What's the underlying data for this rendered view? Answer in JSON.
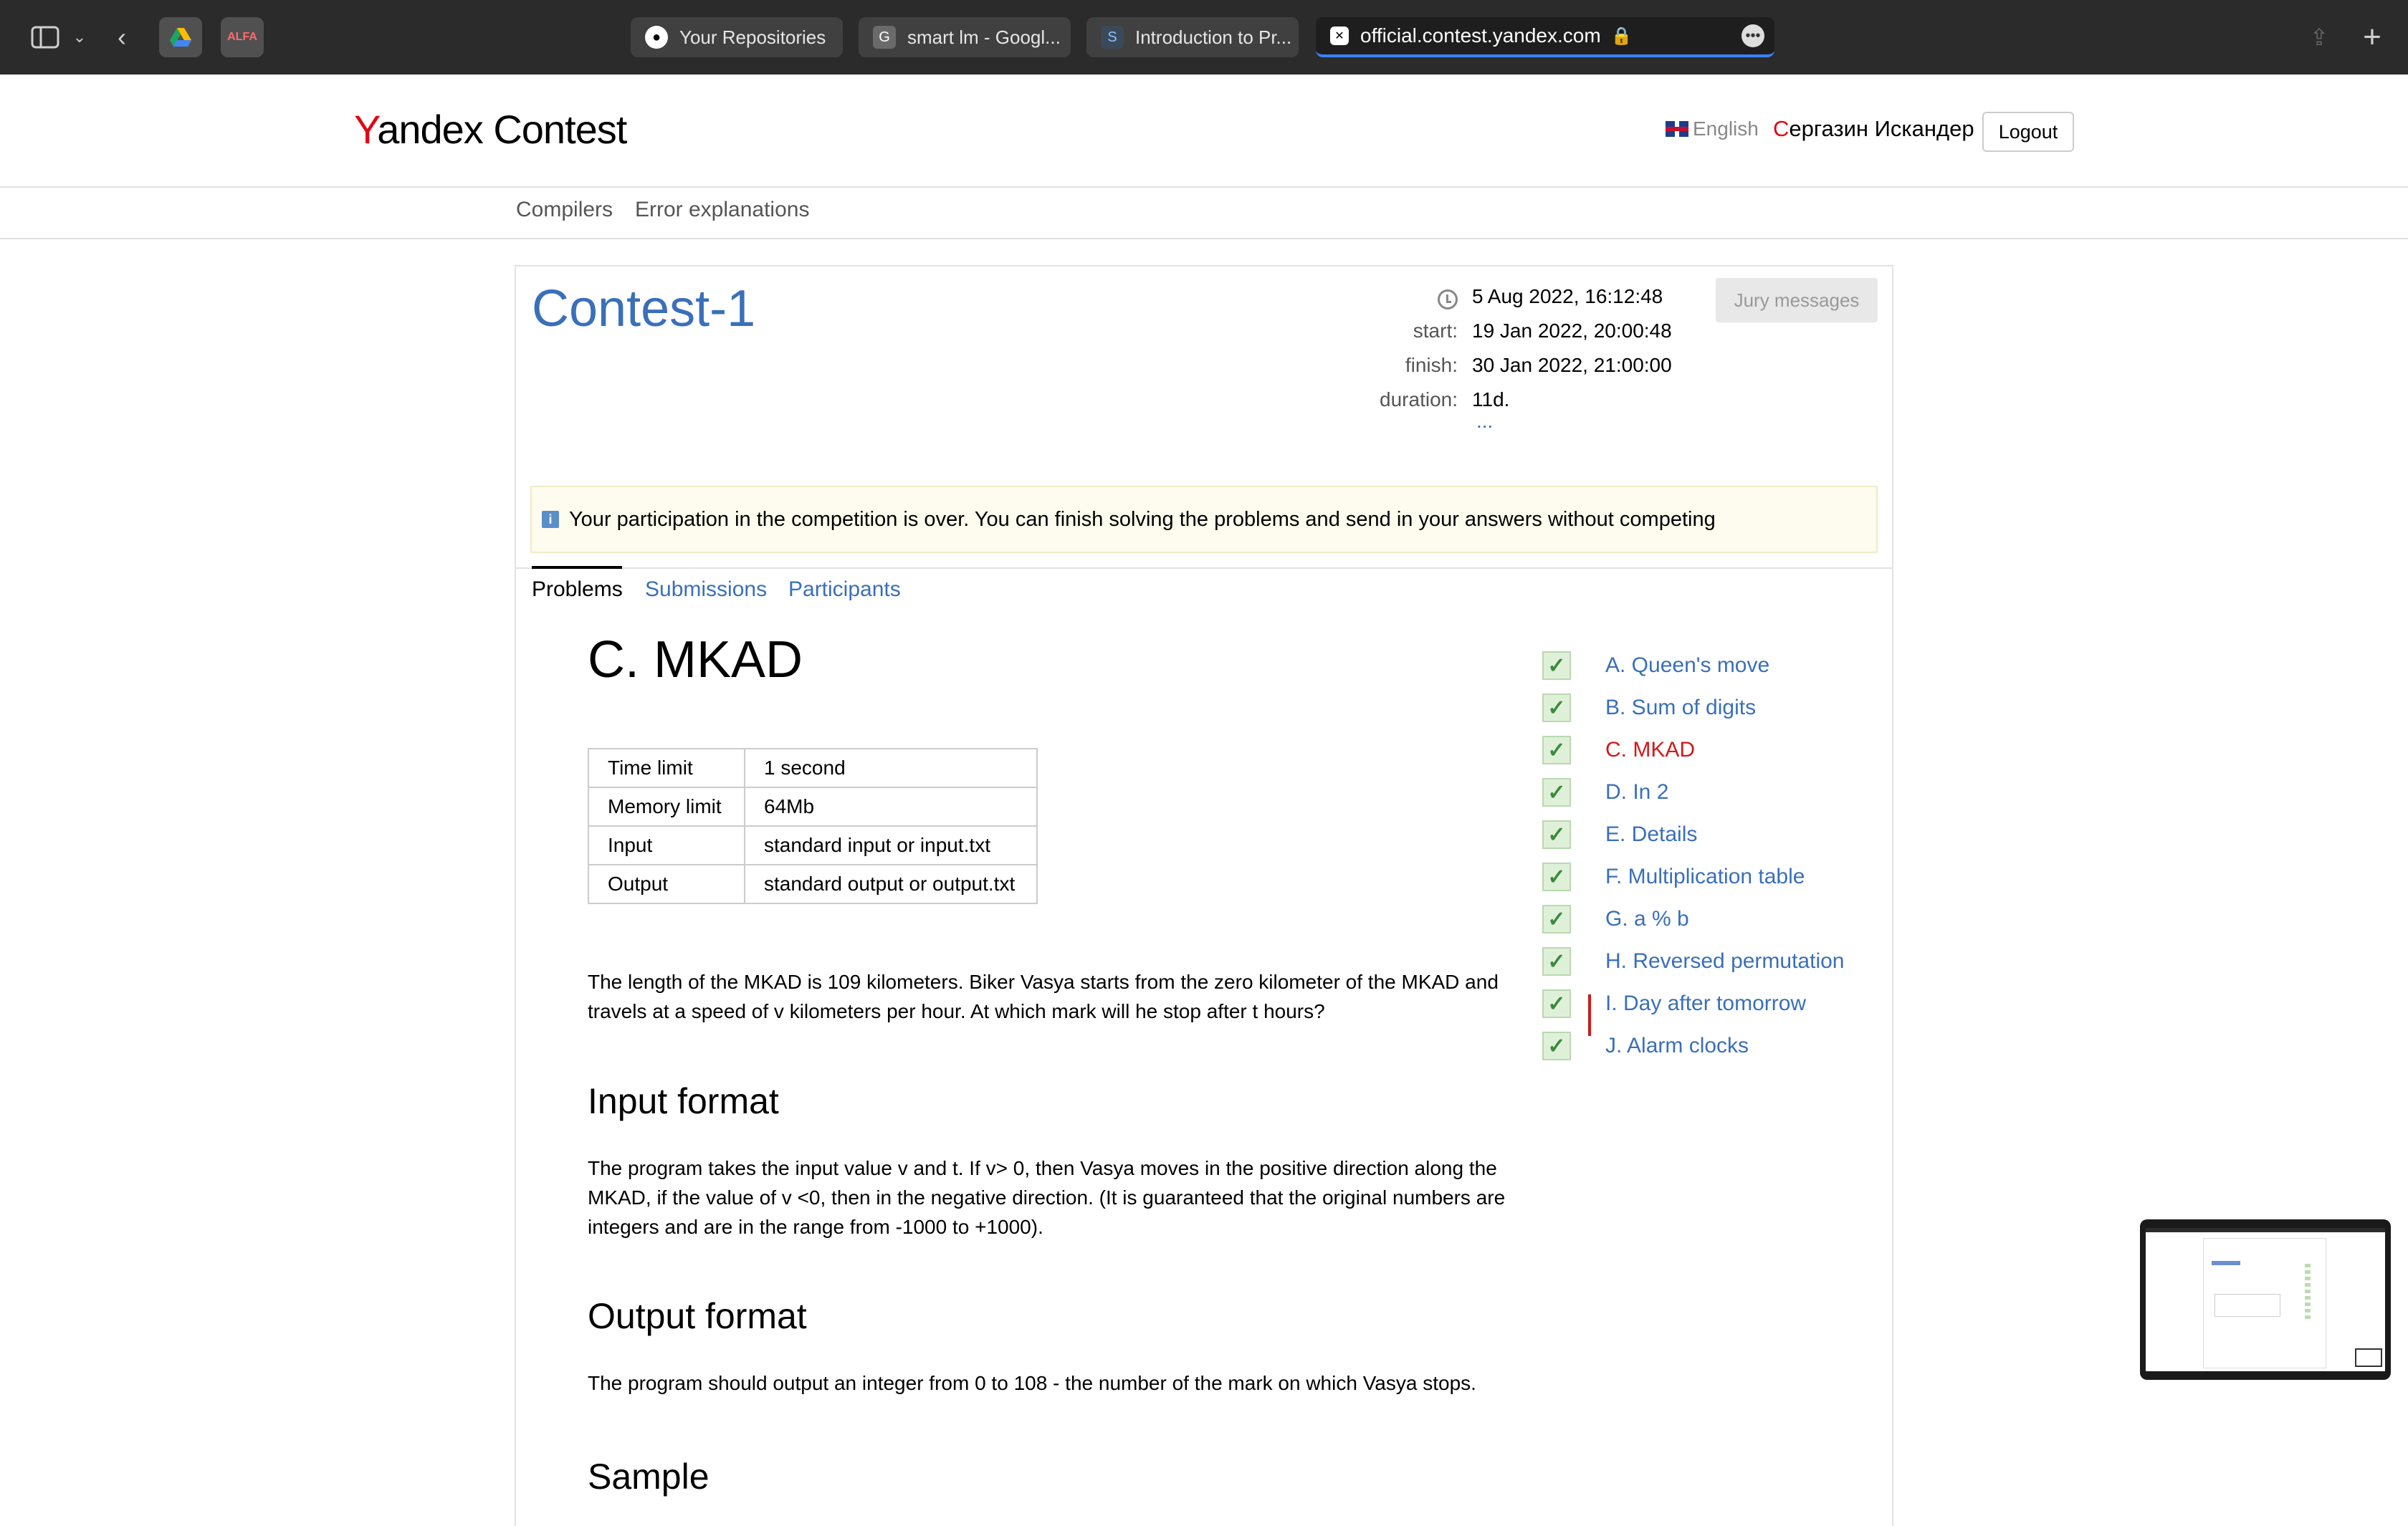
{
  "browser": {
    "tabs": [
      {
        "title": "Your Repositories"
      },
      {
        "title": "smart lm - Googl..."
      },
      {
        "title": "Introduction to Pr..."
      },
      {
        "title": "official.contest.yandex.com"
      }
    ],
    "extensions": [
      "google-drive",
      "ALFA"
    ]
  },
  "header": {
    "logo_y": "Y",
    "logo_rest": "andex",
    "logo_contest": "Contest",
    "language": "English",
    "user_first": "С",
    "user_rest": "ергазин Искандер",
    "logout": "Logout"
  },
  "subnav": {
    "compilers": "Compilers",
    "errors": "Error explanations"
  },
  "contest": {
    "title": "Contest-1",
    "now": "5 Aug 2022, 16:12:48",
    "start_label": "start:",
    "start": "19 Jan 2022, 20:00:48",
    "finish_label": "finish:",
    "finish": "30 Jan 2022, 21:00:00",
    "duration_label": "duration:",
    "duration": "11d.",
    "more": "...",
    "jury_button": "Jury messages",
    "notice": "Your participation in the competition is over. You can finish solving the problems and send in your answers without competing",
    "tabs": [
      "Problems",
      "Submissions",
      "Participants"
    ]
  },
  "problem": {
    "title": "C. MKAD",
    "limits": [
      {
        "key": "Time limit",
        "value": "1 second"
      },
      {
        "key": "Memory limit",
        "value": "64Mb"
      },
      {
        "key": "Input",
        "value": "standard input or input.txt"
      },
      {
        "key": "Output",
        "value": "standard output or output.txt"
      }
    ],
    "statement": "The length of the MKAD is 109 kilometers. Biker Vasya starts from the zero kilometer of the MKAD and travels at a speed of v kilometers per hour. At which mark will he stop after t hours?",
    "input_heading": "Input format",
    "input_text": "The program takes the input value v and t. If v> 0, then Vasya moves in the positive direction along the MKAD, if the value of v <0, then in the negative direction. (It is guaranteed that the original numbers are integers and are in the range from -1000 to +1000).",
    "output_heading": "Output format",
    "output_text": "The program should output an integer from 0 to 108 - the number of the mark on which Vasya stops.",
    "sample_heading": "Sample"
  },
  "problem_list": [
    {
      "label": "A. Queen's move",
      "solved": true
    },
    {
      "label": "B. Sum of digits",
      "solved": true
    },
    {
      "label": "C. MKAD",
      "solved": true,
      "current": true
    },
    {
      "label": "D. In 2",
      "solved": true
    },
    {
      "label": "E. Details",
      "solved": true
    },
    {
      "label": "F. Multiplication table",
      "solved": true
    },
    {
      "label": "G. a % b",
      "solved": true
    },
    {
      "label": "H. Reversed permutation",
      "solved": true
    },
    {
      "label": "I. Day after tomorrow",
      "solved": true
    },
    {
      "label": "J. Alarm clocks",
      "solved": true
    }
  ],
  "colors": {
    "link": "#3a6fba",
    "current": "#d01a1a",
    "brand_red": "#e30613"
  }
}
